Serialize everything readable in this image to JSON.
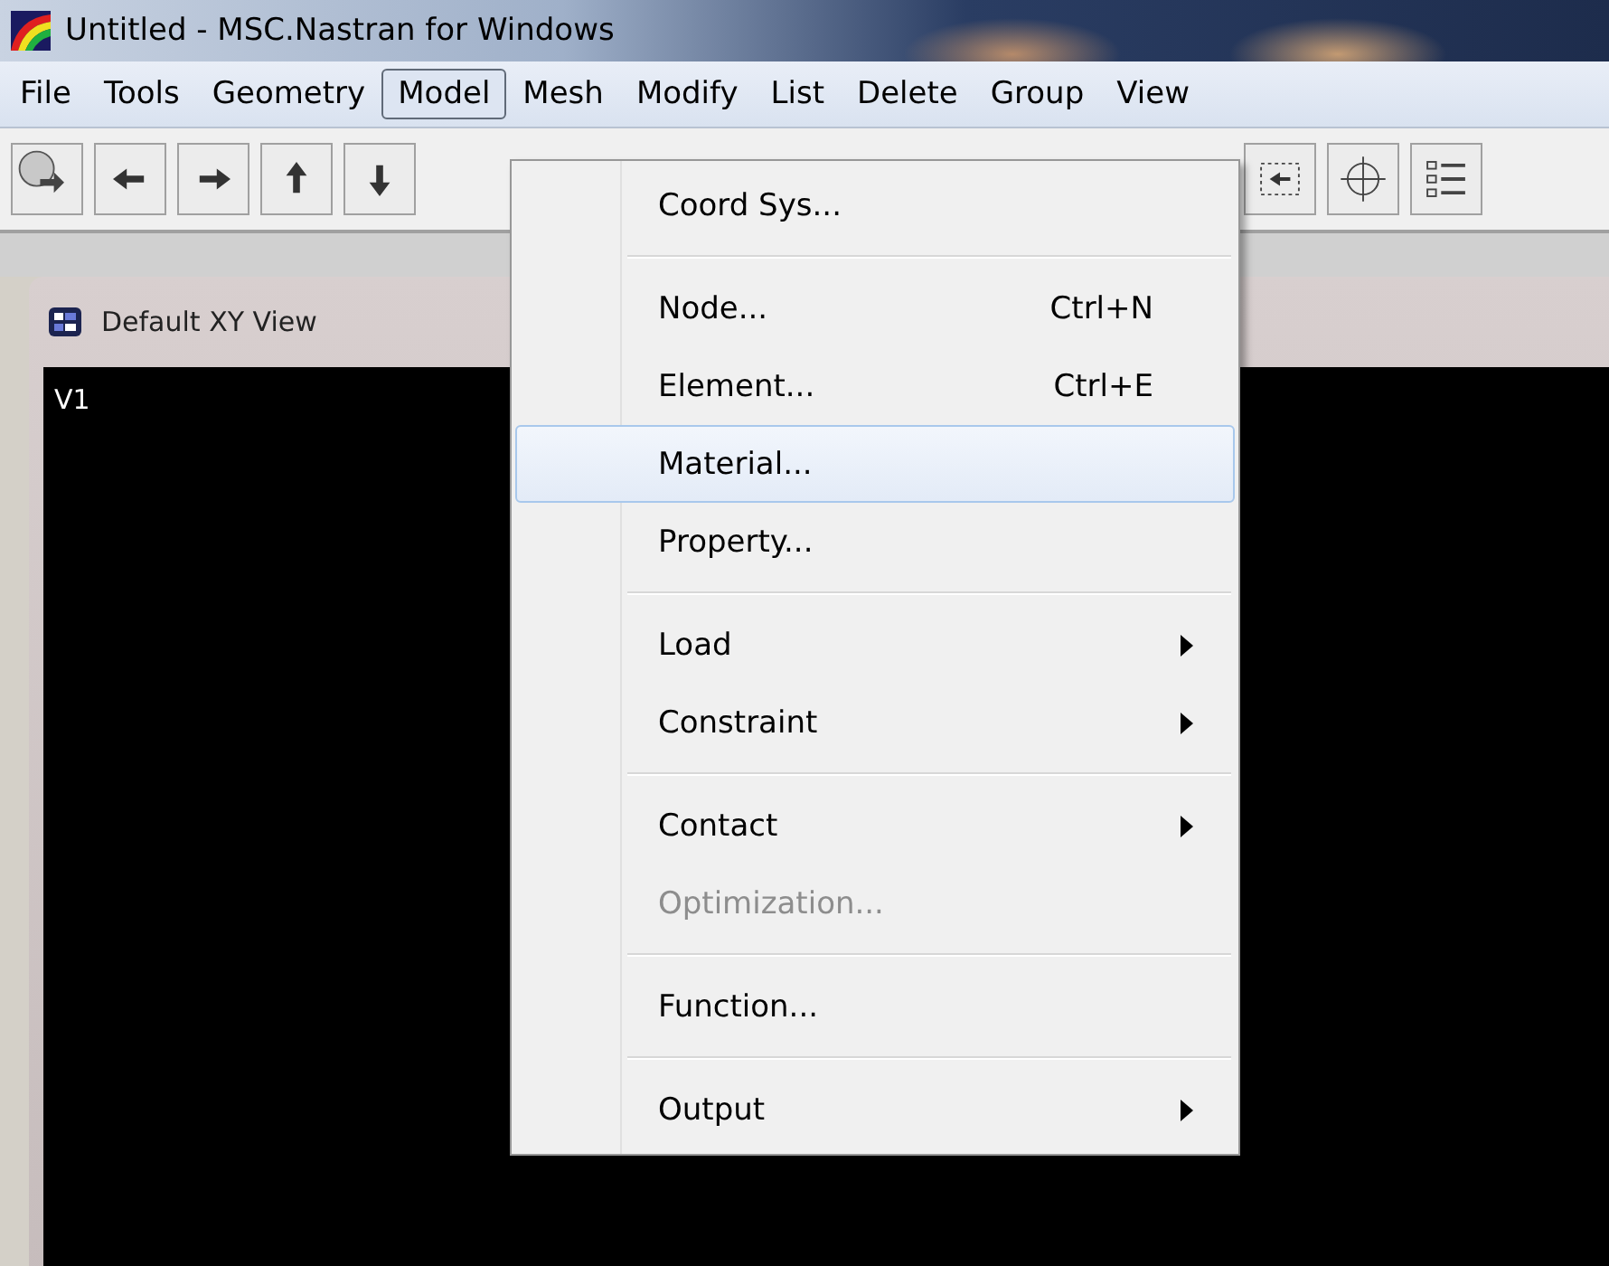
{
  "window": {
    "title": "Untitled - MSC.Nastran for Windows"
  },
  "menu_bar": [
    {
      "label": "File",
      "selected": false
    },
    {
      "label": "Tools",
      "selected": false
    },
    {
      "label": "Geometry",
      "selected": false
    },
    {
      "label": "Model",
      "selected": true
    },
    {
      "label": "Mesh",
      "selected": false
    },
    {
      "label": "Modify",
      "selected": false
    },
    {
      "label": "List",
      "selected": false
    },
    {
      "label": "Delete",
      "selected": false
    },
    {
      "label": "Group",
      "selected": false
    },
    {
      "label": "View",
      "selected": false
    }
  ],
  "view_window": {
    "title": "Default XY View",
    "viewport_label": "V1"
  },
  "dropdown": [
    {
      "kind": "item",
      "label": "Coord Sys...",
      "selected": false,
      "disabled": false,
      "submenu": false
    },
    {
      "kind": "separator"
    },
    {
      "kind": "item",
      "label": "Node...",
      "shortcut": "Ctrl+N",
      "selected": false,
      "disabled": false,
      "submenu": false
    },
    {
      "kind": "item",
      "label": "Element...",
      "shortcut": "Ctrl+E",
      "selected": false,
      "disabled": false,
      "submenu": false
    },
    {
      "kind": "item",
      "label": "Material...",
      "selected": true,
      "disabled": false,
      "submenu": false
    },
    {
      "kind": "item",
      "label": "Property...",
      "selected": false,
      "disabled": false,
      "submenu": false
    },
    {
      "kind": "separator"
    },
    {
      "kind": "item",
      "label": "Load",
      "selected": false,
      "disabled": false,
      "submenu": true
    },
    {
      "kind": "item",
      "label": "Constraint",
      "selected": false,
      "disabled": false,
      "submenu": true
    },
    {
      "kind": "separator"
    },
    {
      "kind": "item",
      "label": "Contact",
      "selected": false,
      "disabled": false,
      "submenu": true
    },
    {
      "kind": "item",
      "label": "Optimization...",
      "selected": false,
      "disabled": true,
      "submenu": false
    },
    {
      "kind": "separator"
    },
    {
      "kind": "item",
      "label": "Function...",
      "selected": false,
      "disabled": false,
      "submenu": false
    },
    {
      "kind": "separator"
    },
    {
      "kind": "item",
      "label": "Output",
      "selected": false,
      "disabled": false,
      "submenu": true
    }
  ]
}
